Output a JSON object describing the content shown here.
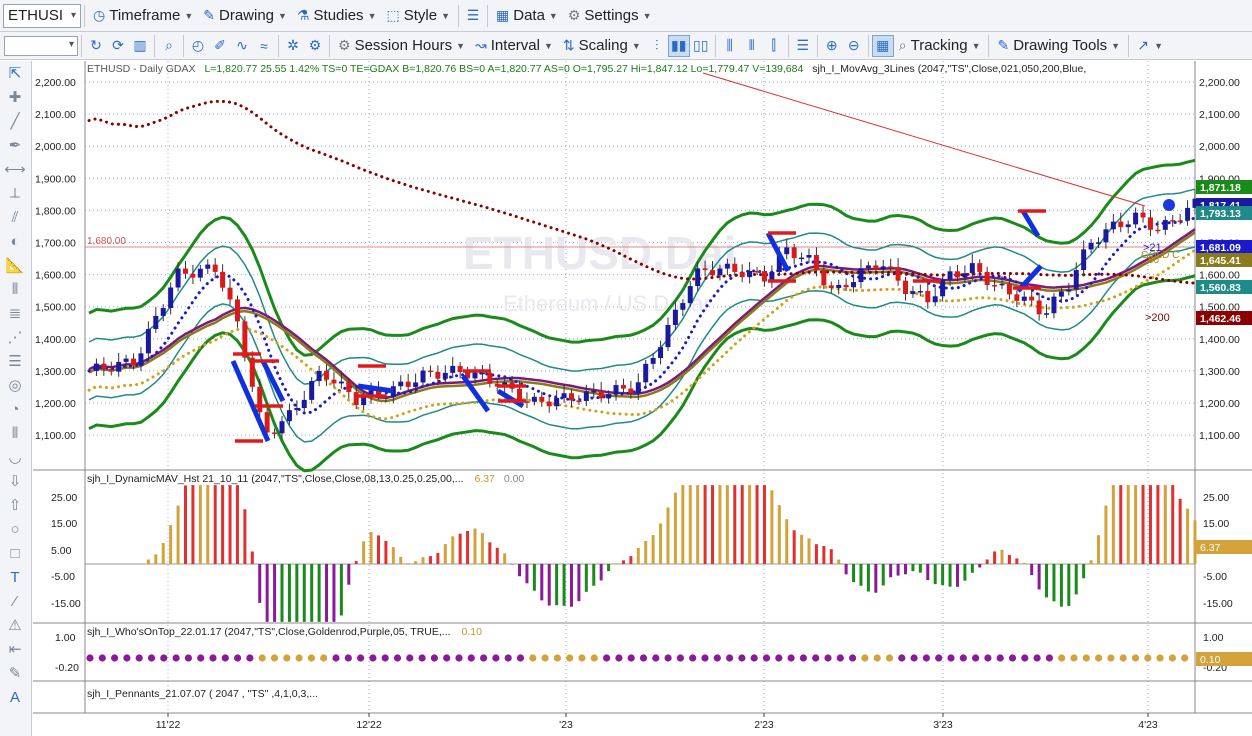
{
  "toolbar1": {
    "symbol": "ETHUSI",
    "items": [
      {
        "id": "timeframe",
        "label": "Timeframe",
        "icon": "clock-icon"
      },
      {
        "id": "drawing",
        "label": "Drawing",
        "icon": "pencil-icon"
      },
      {
        "id": "studies",
        "label": "Studies",
        "icon": "flask-icon"
      },
      {
        "id": "style",
        "label": "Style",
        "icon": "style-icon"
      },
      {
        "id": "data",
        "label": "Data",
        "icon": "grid-icon"
      },
      {
        "id": "settings",
        "label": "Settings",
        "icon": "gear-icon"
      }
    ]
  },
  "toolbar2": {
    "session_hours": "Session Hours",
    "interval": "Interval",
    "scaling": "Scaling",
    "tracking": "Tracking",
    "drawing_tools": "Drawing Tools"
  },
  "chart": {
    "header": "ETHUSD - Daily GDAX",
    "stats": "L=1,820.77  25.55  1.42%  TS=0  TE=GDAX  B=1,820.76  BS=0  A=1,820.77  AS=0  O=1,795.27  Hi=1,847.12  Lo=1,779.47  V=139,684",
    "indicator": "sjh_I_MovAvg_3Lines (2047,\"TS\",Close,021,050,200,Blue,",
    "watermark": "ETHUSD,Dai",
    "watermark_sub": "Ethereum / US Dollar",
    "hline_label": "1,680.00",
    "colors": {
      "up": "#1a1a9e",
      "down": "#d81a1a",
      "ma21": "#1a1acc",
      "ma50": "#d4a017",
      "ma200": "#8b0000",
      "envelope": "#1a8a1a",
      "inner": "#1f8a8a",
      "trend": "#e03030"
    },
    "price_axis": [
      "2,200.00",
      "2,100.00",
      "2,000.00",
      "1,900.00",
      "1,800.00",
      "1,700.00",
      "1,600.00",
      "1,500.00",
      "1,400.00",
      "1,300.00",
      "1,200.00",
      "1,100.00"
    ],
    "right_tags": [
      {
        "text": "1,871.18",
        "bg": "#1a8a1a"
      },
      {
        "text": "1,817.41",
        "bg": "#1a1a9e"
      },
      {
        "text": "1,793.13",
        "bg": "#1f8a8a"
      },
      {
        "text": "1,681.09",
        "bg": "#1a1acc"
      },
      {
        "text": "1,645.41",
        "bg": "#8a7a1a"
      },
      {
        "text": "1,560.83",
        "bg": "#1f8a8a"
      },
      {
        "text": "1,462.46",
        "bg": "#8b0000"
      }
    ],
    "ma_labels": {
      "ma21": ">21",
      "ma50": "GOLD C",
      "ma50b": "50",
      "ma200": ">200"
    },
    "x_labels": [
      "11'22",
      "12'22",
      "'23",
      "2'23",
      "3'23",
      "4'23"
    ]
  },
  "pane2": {
    "title": "sjh_I_DynamicMAV_Hst 21_10_11 (2047,\"TS\",Close,Close,08,13,0.25,0.25,00,...",
    "val1": "6.37",
    "val2": "0.00",
    "axis": [
      "25.00",
      "15.00",
      "5.00",
      "-5.00",
      "-15.00"
    ],
    "tag": "6.37"
  },
  "pane3": {
    "title": "sjh_I_Who'sOnTop_22.01.17 (2047,\"TS\",Close,Goldenrod,Purple,05, TRUE,...",
    "val1": "0.10",
    "axis": [
      "1.00",
      "-0.20"
    ],
    "tag": "0.10"
  },
  "pane4": {
    "title": "sjh_I_Pennants_21.07.07 ( 2047 , \"TS\" ,4,1,0,3,..."
  },
  "chart_data": {
    "type": "candlestick",
    "title": "ETHUSD - Daily GDAX",
    "ylim": [
      1050,
      2250
    ],
    "x": [
      "11'22",
      "12'22",
      "'23",
      "2'23",
      "3'23",
      "4'23"
    ],
    "last": {
      "open": 1795.27,
      "high": 1847.12,
      "low": 1779.47,
      "close": 1820.77,
      "volume": 139684
    },
    "series": [
      {
        "name": "21",
        "last": 1681.09
      },
      {
        "name": "50",
        "last": 1645.41
      },
      {
        "name": "200",
        "last": 1462.46
      }
    ]
  }
}
